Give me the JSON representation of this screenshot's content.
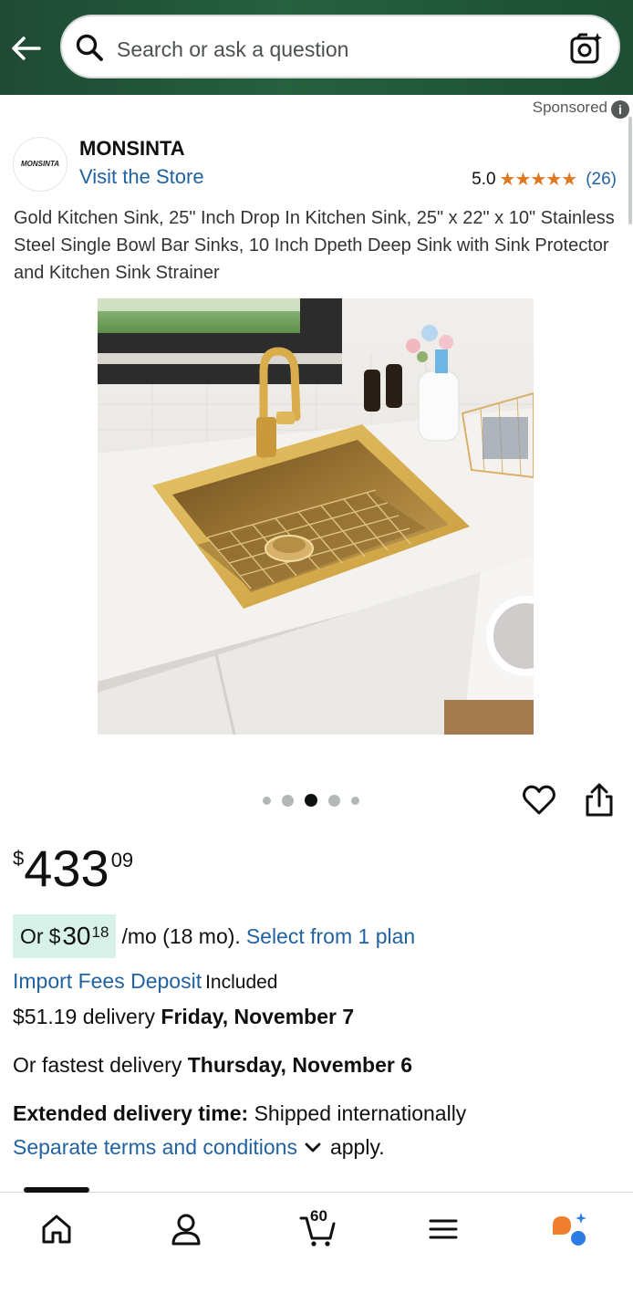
{
  "search": {
    "placeholder": "Search or ask a question"
  },
  "sponsored": {
    "label": "Sponsored"
  },
  "brand": {
    "logo_text": "MONSINTA",
    "name": "MONSINTA",
    "visit_store": "Visit the Store"
  },
  "rating": {
    "value": "5.0",
    "stars": "★★★★★",
    "count": "(26)"
  },
  "product": {
    "title": "Gold Kitchen Sink, 25\" Inch Drop In Kitchen Sink, 25\" x 22\" x 10\" Stainless Steel Single Bowl Bar Sinks, 10 Inch Dpeth Deep Sink with Sink Protector and Kitchen Sink Strainer",
    "image_count": 5,
    "active_image_index": 2
  },
  "price": {
    "symbol": "$",
    "whole": "433",
    "fraction": "09"
  },
  "monthly": {
    "prefix": "Or",
    "symbol": "$",
    "whole": "30",
    "fraction": "18",
    "rest": "/mo (18 mo).",
    "plan_link": "Select from 1 plan"
  },
  "import_fees": {
    "link": "Import Fees Deposit",
    "status": "Included"
  },
  "delivery": {
    "price_text": "$51.19 delivery",
    "date": "Friday, November 7"
  },
  "fastest": {
    "prefix": "Or fastest delivery",
    "date": "Thursday, November 6"
  },
  "extended": {
    "label": "Extended delivery time:",
    "text": "Shipped internationally"
  },
  "terms": {
    "link": "Separate terms and conditions",
    "suffix": "apply."
  },
  "bottom_nav": {
    "cart_count": "60",
    "items": [
      "home-icon",
      "account-icon",
      "cart-icon",
      "menu-icon",
      "assistant-icon"
    ]
  },
  "colors": {
    "header_green": "#25603f",
    "link_blue": "#2162a1",
    "star_orange": "#de7921",
    "monthly_highlight": "#d9f2e9"
  }
}
